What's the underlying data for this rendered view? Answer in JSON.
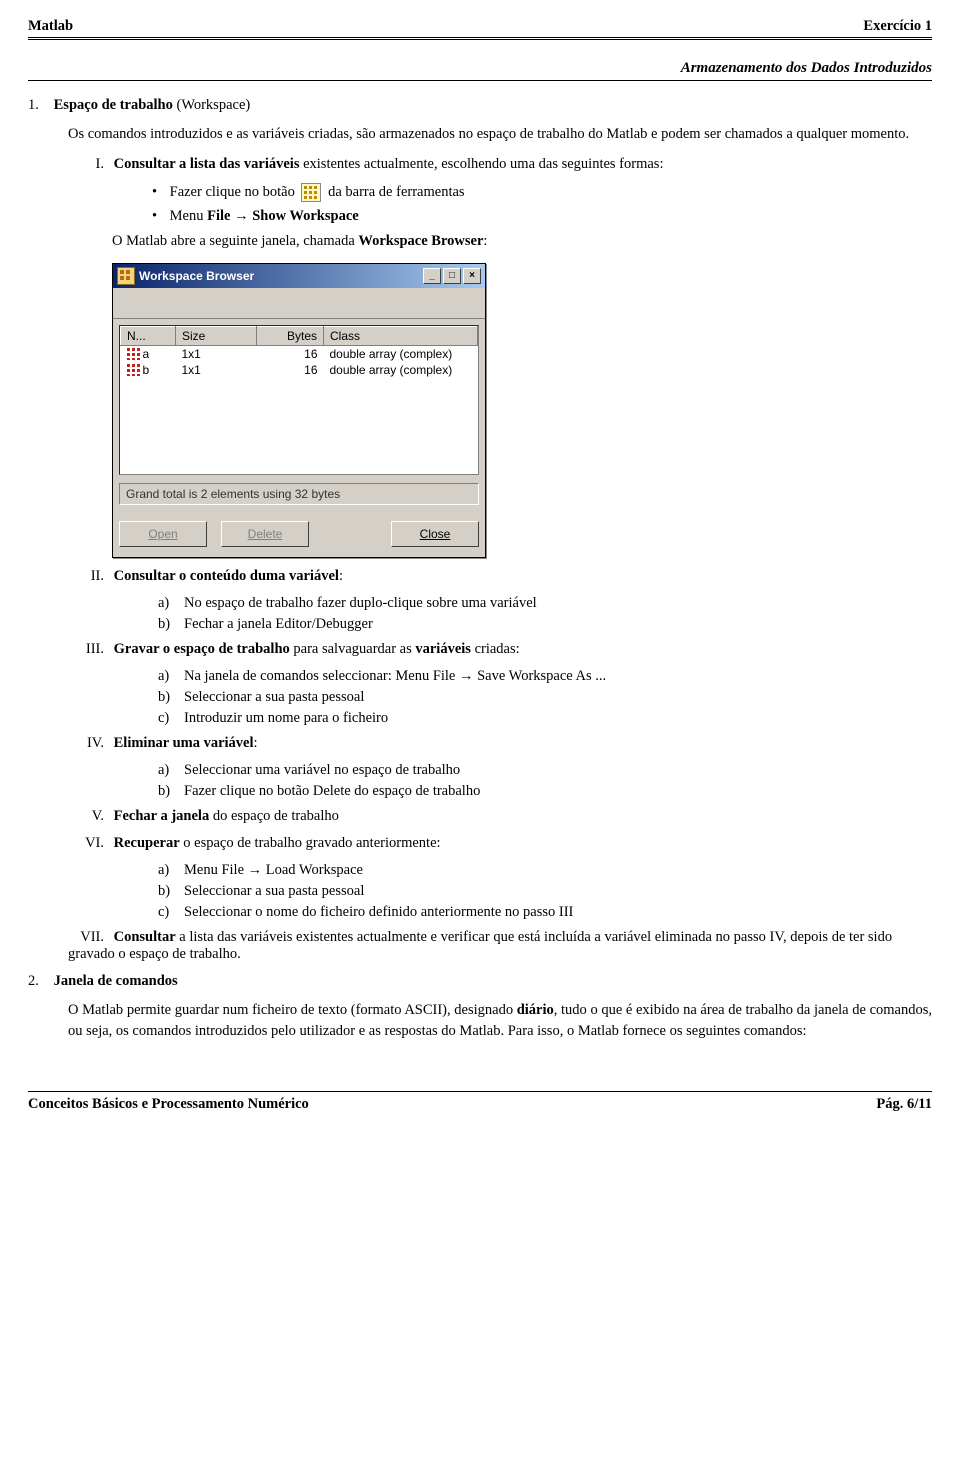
{
  "header": {
    "left": "Matlab",
    "right": "Exercício 1"
  },
  "subtitle": "Armazenamento dos Dados Introduzidos",
  "s1": {
    "num": "1.",
    "title_strong": "Espaço de trabalho",
    "title_rest": " (Workspace)",
    "para": "Os comandos introduzidos e as variáveis criadas, são armazenados no espaço de trabalho do Matlab e podem ser chamados a qualquer momento."
  },
  "rI": {
    "num": "I.",
    "lead_strong": "Consultar a lista das variáveis",
    "lead_rest": " existentes actualmente, escolhendo uma das seguintes formas:",
    "b1_pre": "Fazer clique no botão ",
    "b1_post": " da barra de ferramentas",
    "b2_pre": "Menu ",
    "b2_file": "File",
    "b2_arrow": " → ",
    "b2_show": "Show Workspace",
    "after_pre": "O Matlab abre a seguinte janela, chamada ",
    "after_strong": "Workspace Browser",
    "after_post": ":"
  },
  "wb": {
    "title": "Workspace Browser",
    "cols": {
      "c1": "N...",
      "c2": "Size",
      "c3": "Bytes",
      "c4": "Class"
    },
    "rows": [
      {
        "name": "a",
        "size": "1x1",
        "bytes": "16",
        "class": "double array (complex)"
      },
      {
        "name": "b",
        "size": "1x1",
        "bytes": "16",
        "class": "double array (complex)"
      }
    ],
    "status": "Grand total is 2 elements using 32 bytes",
    "btn_open": "Open",
    "btn_delete": "Delete",
    "btn_close": "Close",
    "win_min": "_",
    "win_max": "□",
    "win_close": "×"
  },
  "rII": {
    "num": "II.",
    "title": "Consultar o conteúdo duma variável",
    "post": ":",
    "a": "No espaço de trabalho fazer duplo-clique sobre uma variável",
    "b": "Fechar a janela Editor/Debugger"
  },
  "rIII": {
    "num": "III.",
    "title": "Gravar o espaço de trabalho",
    "rest": " para salvaguardar as ",
    "vars": "variáveis",
    "rest2": " criadas:",
    "a": "Na janela de comandos seleccionar: Menu File → Save Workspace As ...",
    "b": "Seleccionar a sua pasta pessoal",
    "c": "Introduzir um nome para o ficheiro"
  },
  "rIV": {
    "num": "IV.",
    "title": "Eliminar uma variável",
    "post": ":",
    "a": "Seleccionar uma variável no espaço de trabalho",
    "b": "Fazer clique no botão Delete do espaço de trabalho"
  },
  "rV": {
    "num": "V.",
    "title": "Fechar a janela",
    "rest": " do espaço de trabalho"
  },
  "rVI": {
    "num": "VI.",
    "title": "Recuperar",
    "rest": " o espaço de trabalho gravado anteriormente:",
    "a": "Menu File → Load Workspace",
    "b": "Seleccionar a sua pasta pessoal",
    "c": "Seleccionar o nome do ficheiro definido anteriormente no passo III"
  },
  "rVII": {
    "num": "VII.",
    "title": "Consultar",
    "rest": " a lista das variáveis existentes actualmente e verificar que está incluída a variável eliminada no passo IV, depois de ter sido gravado o espaço de trabalho."
  },
  "s2": {
    "num": "2.",
    "title": "Janela de comandos",
    "p_pre": "O Matlab permite guardar num ficheiro de texto (formato ASCII), designado ",
    "p_strong": "diário",
    "p_post": ", tudo o que é exibido na área de trabalho da janela de comandos, ou seja, os comandos introduzidos pelo utilizador e as respostas do Matlab. Para isso, o Matlab fornece os seguintes comandos:"
  },
  "footer": {
    "left": "Conceitos Básicos e Processamento Numérico",
    "right": "Pág. 6/11"
  },
  "labels": {
    "a": "a)",
    "b": "b)",
    "c": "c)",
    "bullet": "•"
  }
}
